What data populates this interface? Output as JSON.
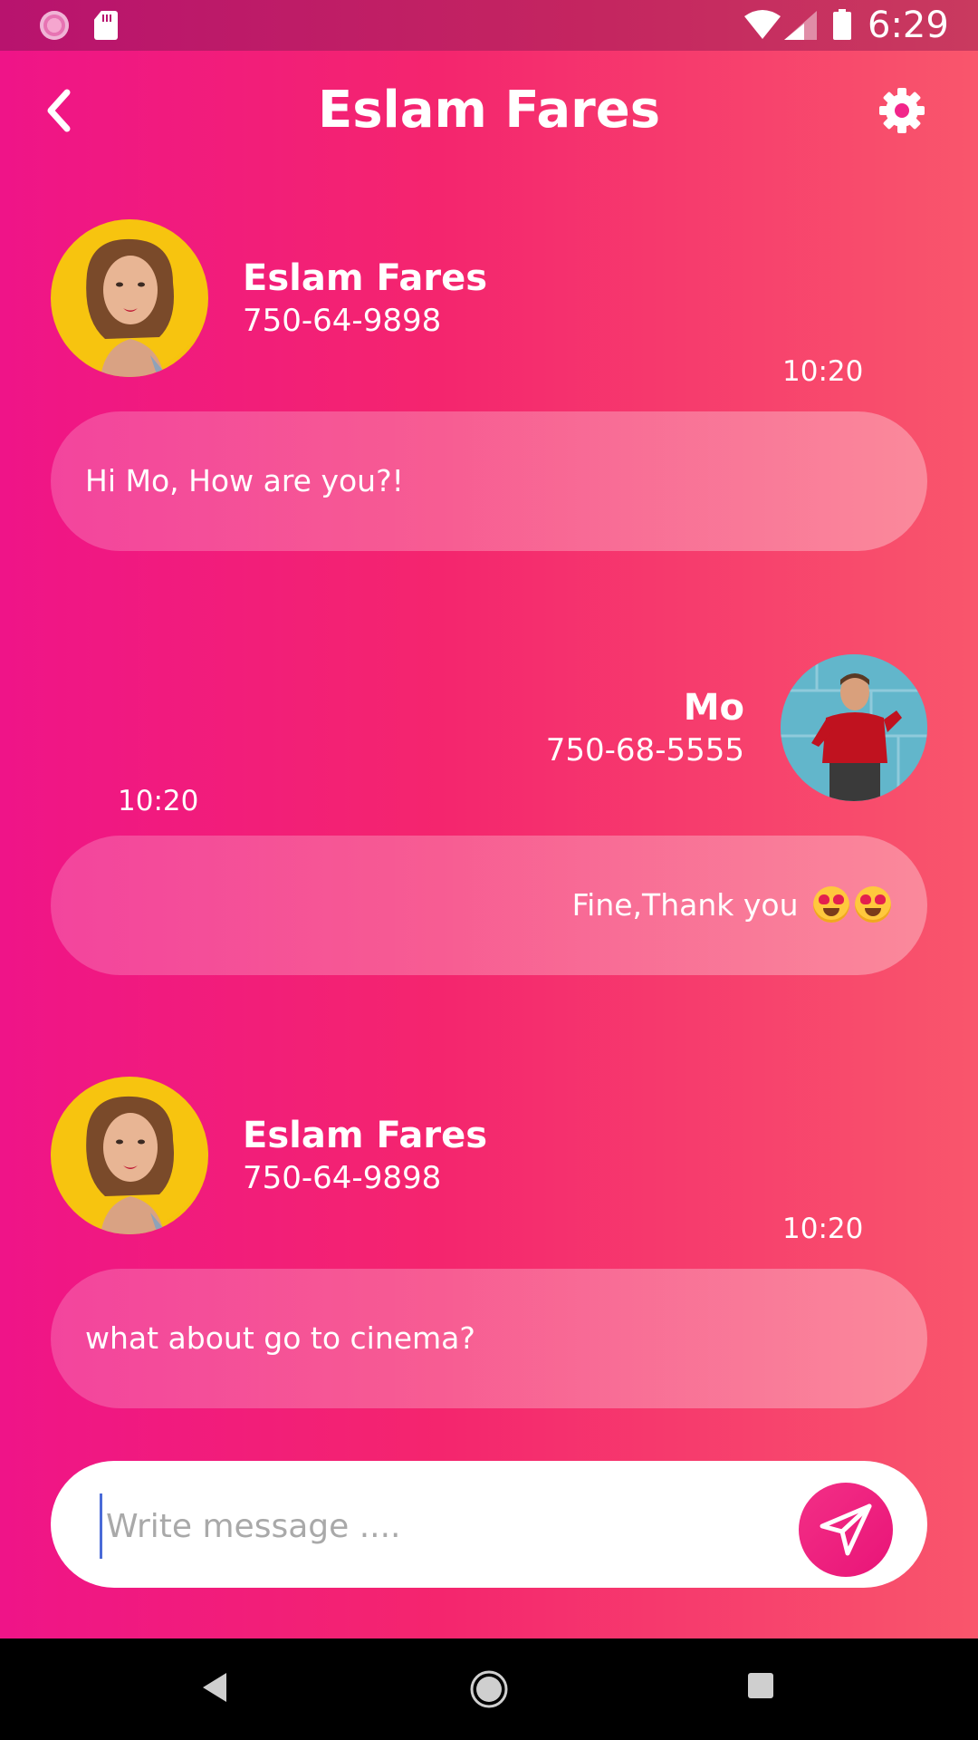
{
  "status_bar": {
    "time": "6:29"
  },
  "header": {
    "title": "Eslam Fares"
  },
  "messages": [
    {
      "sender": "Eslam Fares",
      "phone": "750-64-9898",
      "time": "10:20",
      "text": "Hi Mo, How are you?!"
    },
    {
      "sender": "Mo",
      "phone": "750-68-5555",
      "time": "10:20",
      "text": "Fine,Thank you"
    },
    {
      "sender": "Eslam Fares",
      "phone": "750-64-9898",
      "time": "10:20",
      "text": "what about go to cinema?"
    }
  ],
  "composer": {
    "placeholder": "Write message ...."
  },
  "colors": {
    "gradient_start": "#ef1488",
    "gradient_end": "#f9566c",
    "send_button": "#e91478"
  },
  "icons": {
    "back": "chevron-left-icon",
    "settings": "gear-icon",
    "send": "paper-plane-icon",
    "emoji": "heart-eyes-emoji"
  }
}
